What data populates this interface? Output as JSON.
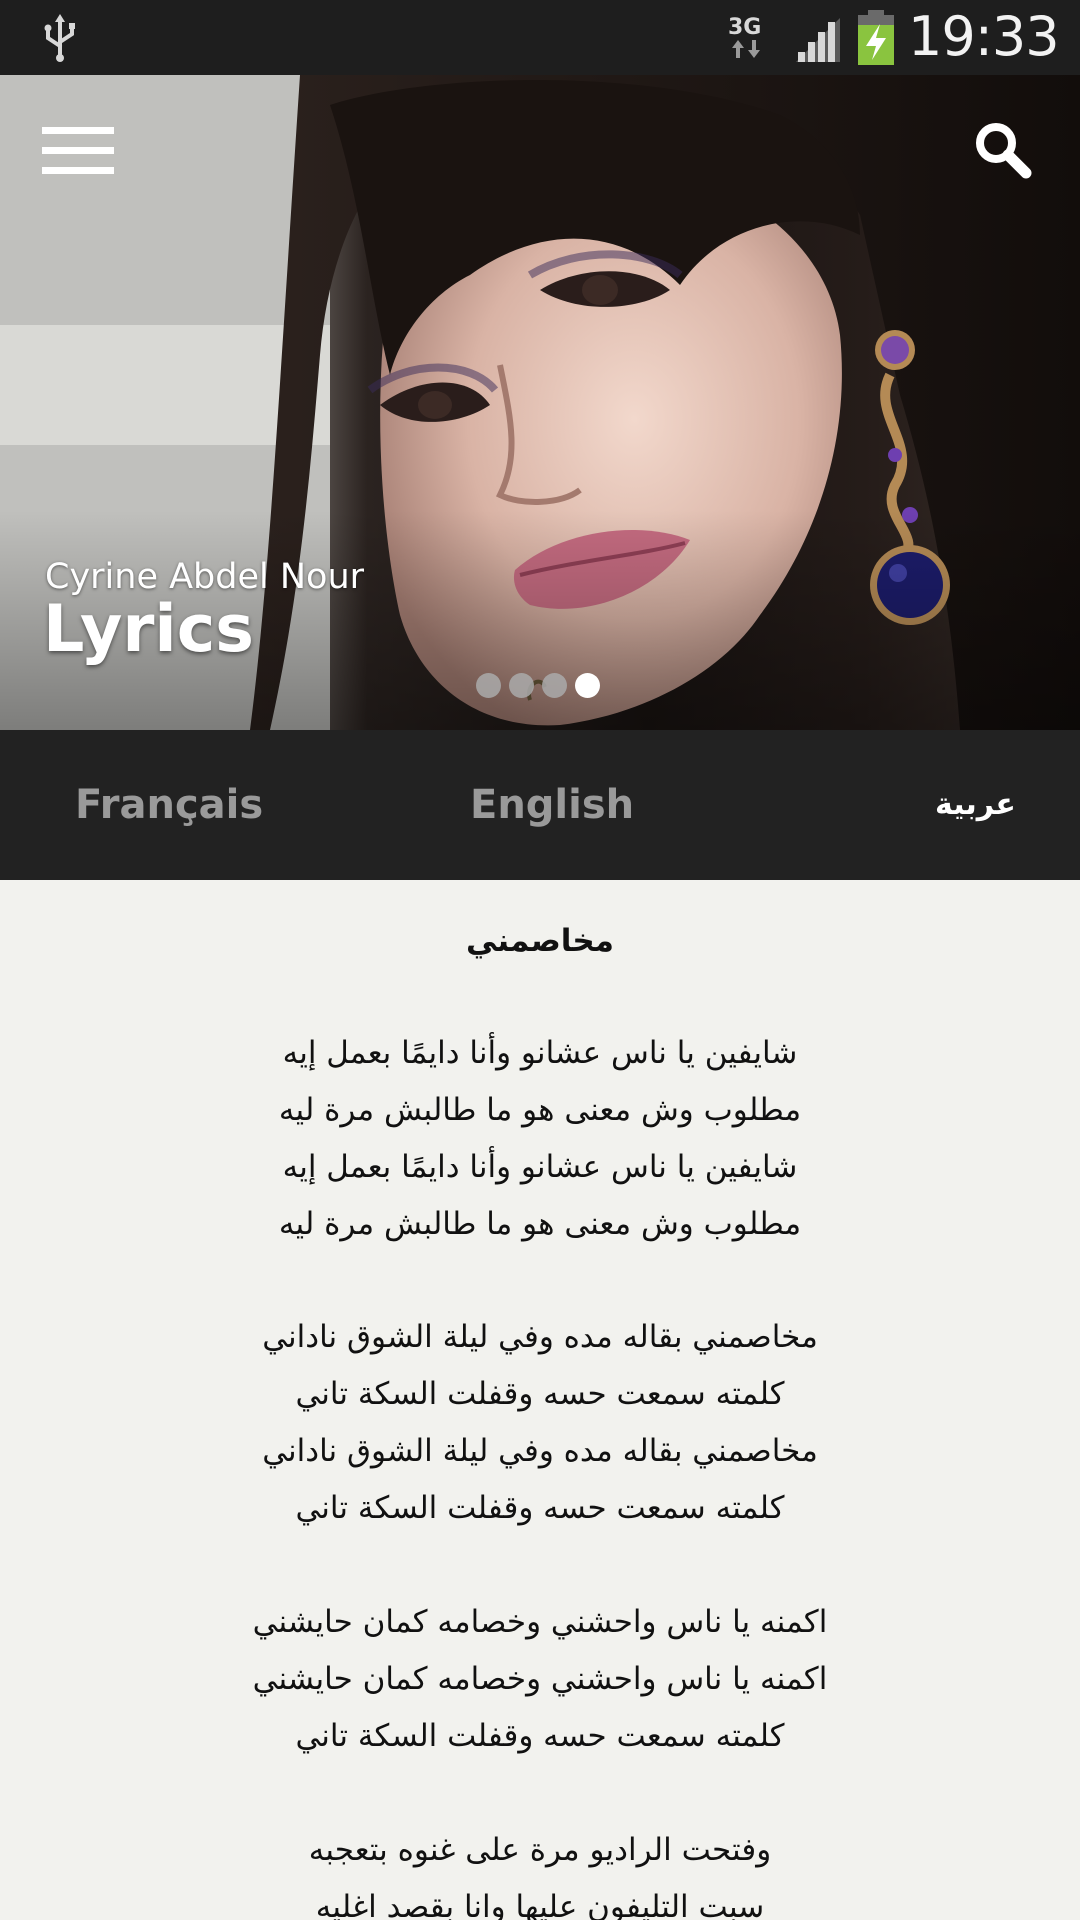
{
  "status_bar": {
    "network": "3G",
    "time": "19:33",
    "icons": [
      "usb-icon",
      "network-3g-icon",
      "signal-icon",
      "battery-charging-icon"
    ]
  },
  "hero": {
    "artist": "Cyrine Abdel Nour",
    "title": "Lyrics",
    "pager": {
      "count": 4,
      "active": 4
    }
  },
  "tabs": [
    {
      "label": "Français",
      "active": false
    },
    {
      "label": "English",
      "active": false
    },
    {
      "label": "عربية",
      "active": true
    }
  ],
  "lyrics": {
    "title": "مخاصمني",
    "lines": [
      "شايفين يا ناس عشانو وأنا دايمًا بعمل إيه",
      "مطلوب وش معنى هو ما طالبش مرة ليه",
      "شايفين يا ناس عشانو وأنا دايمًا بعمل إيه",
      "مطلوب وش معنى هو ما طالبش مرة ليه",
      "",
      "مخاصمني بقاله مده وفي ليلة الشوق ناداني",
      "كلمته سمعت حسه وقفلت السكة تاني",
      "مخاصمني بقاله مده وفي ليلة الشوق ناداني",
      "كلمته سمعت حسه وقفلت السكة تاني",
      "",
      "اكمنه يا ناس واحشني وخصامه كمان حايشني",
      "اكمنه يا ناس واحشني وخصامه كمان حايشني",
      "كلمته سمعت حسه وقفلت السكة تاني",
      "",
      "وفتحت الراديو مرة على غنوه بتعجبه",
      "سبت التليفون عليها وانا بقصد اغليه"
    ]
  },
  "colors": {
    "status_bar": "#1e1e1e",
    "tab_bar": "#222222",
    "tab_active": "#ffffff",
    "tab_inactive": "#9a9a9a",
    "lyrics_background": "#f2f2ee",
    "battery": "#8ac43f"
  }
}
